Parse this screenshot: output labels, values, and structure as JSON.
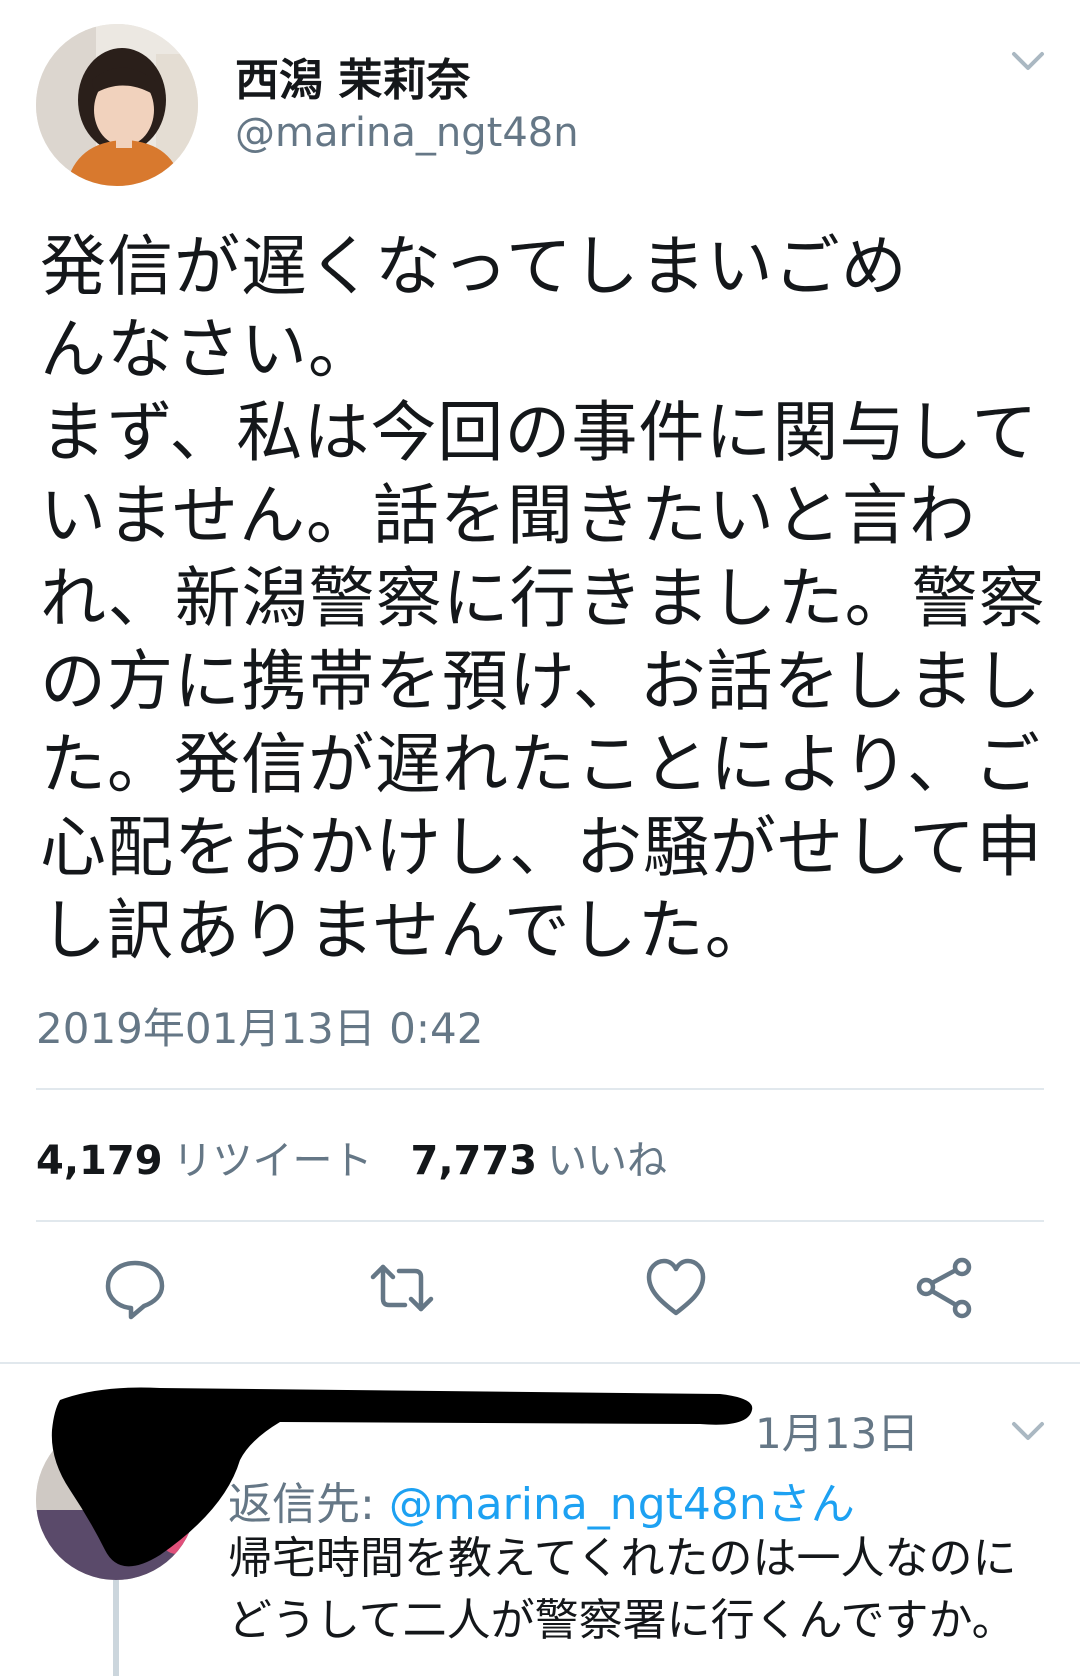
{
  "tweet": {
    "display_name": "西潟 茉莉奈",
    "handle": "@marina_ngt48n",
    "body_lines": [
      "発信が遅くなってしまいごめ",
      "んなさい。",
      "まず、私は今回の事件に関与して",
      "いません。話を聞きたいと言わ",
      "れ、新潟警察に行きました。警察",
      "の方に携帯を預け、お話をしまし",
      "た。発信が遅れたことにより、ご",
      "心配をおかけし、お騒がせして申",
      "し訳ありませんでした。"
    ],
    "timestamp": "2019年01月13日 0:42",
    "retweet_count": "4,179",
    "retweet_label": "リツイート",
    "like_count": "7,773",
    "like_label": "いいね"
  },
  "actions": {
    "icons": [
      "reply-icon",
      "retweet-icon",
      "like-icon",
      "share-icon"
    ]
  },
  "reply": {
    "date": "1月13日",
    "reply_to_prefix": "返信先: ",
    "reply_to_mention": "@marina_ngt48nさん",
    "text_lines": [
      "帰宅時間を教えてくれたのは一人なのに",
      "どうして二人が警察署に行くんですか。"
    ]
  },
  "colors": {
    "text_primary": "#14171a",
    "text_secondary": "#657786",
    "link": "#1da1f2",
    "divider": "#e1e8ed",
    "redaction": "#000000"
  }
}
